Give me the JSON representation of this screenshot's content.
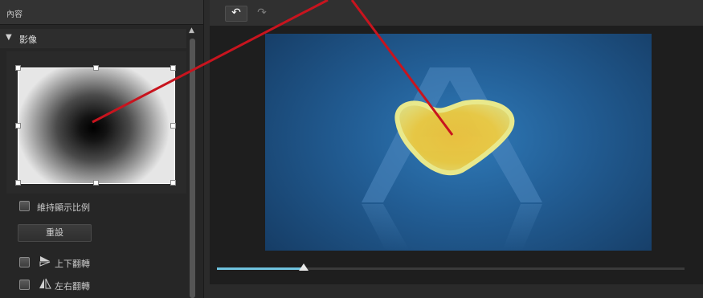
{
  "panel": {
    "title": "內容",
    "section_arrow": "▼",
    "section_title": "影像"
  },
  "options": {
    "keep_ratio_label": "維持顯示比例",
    "reset_label": "重設",
    "flip_vertical_label": "上下翻轉",
    "flip_horizontal_label": "左右翻轉"
  },
  "toolbar": {
    "undo_glyph": "↶",
    "redo_glyph": "↷"
  },
  "timeline": {
    "progress": 0.186
  },
  "colors": {
    "annotation": "#c8141e",
    "slider_fill": "#6fc3de"
  },
  "icons": {
    "flip_vertical": "flip-vertical-icon",
    "flip_horizontal": "flip-horizontal-icon",
    "scroll_up": "scroll-up-icon"
  }
}
